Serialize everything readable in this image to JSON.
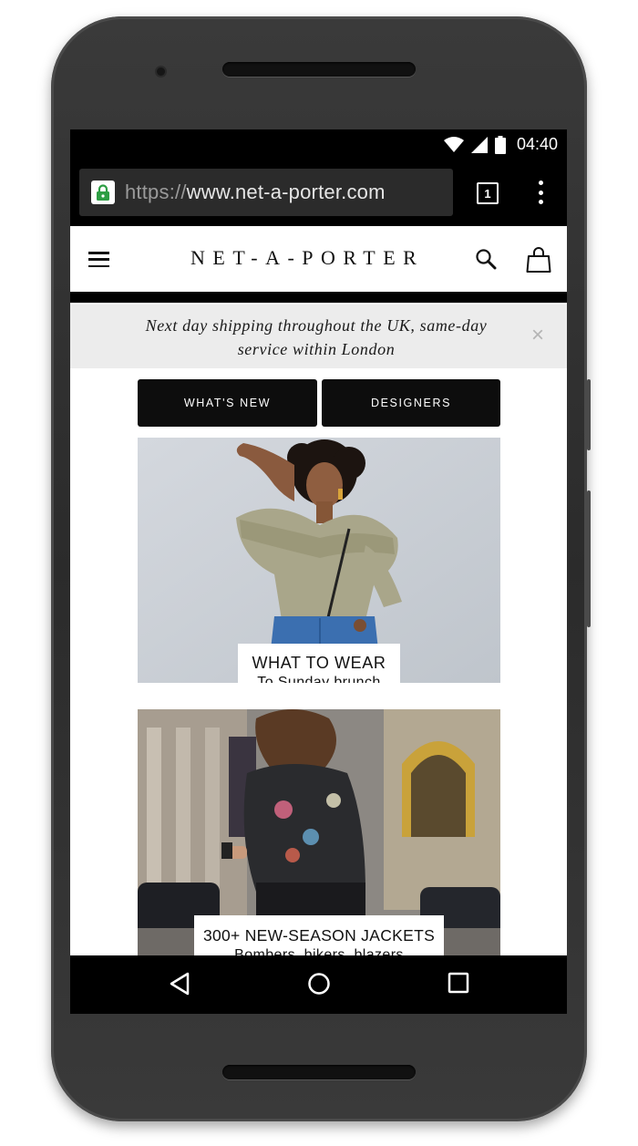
{
  "status_bar": {
    "time": "04:40"
  },
  "browser": {
    "url_scheme": "https://",
    "url_host": "www.net-a-porter.com",
    "tab_count": "1"
  },
  "site": {
    "logo": "NET-A-PORTER",
    "banner_text": "Next day shipping throughout the UK, same-day service within London",
    "banner_close": "×",
    "nav_buttons": [
      "WHAT'S NEW",
      "DESIGNERS"
    ]
  },
  "promos": [
    {
      "title": "WHAT TO WEAR",
      "subtitle": "To Sunday brunch"
    },
    {
      "title": "300+ NEW-SEASON JACKETS",
      "subtitle": "Bombers, bikers, blazers"
    }
  ],
  "colors": {
    "frame": "#2b2b2b",
    "screen_bg": "#000000",
    "banner_bg": "#ececec",
    "button_bg": "#0d0d0d",
    "lock_green": "#2e9e44"
  },
  "icons": [
    "wifi-icon",
    "signal-icon",
    "battery-icon",
    "lock-icon",
    "tab-switcher-icon",
    "overflow-menu-icon",
    "hamburger-menu-icon",
    "search-icon",
    "shopping-bag-icon",
    "back-icon",
    "home-icon",
    "recents-icon"
  ]
}
